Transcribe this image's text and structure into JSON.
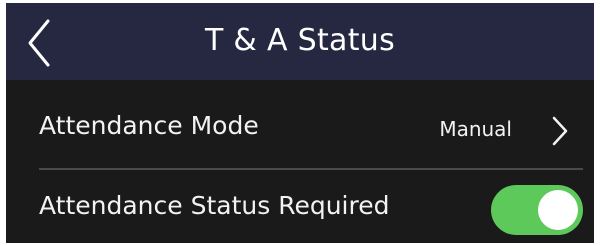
{
  "header": {
    "title": "T & A Status",
    "back_icon": "chevron-left-icon"
  },
  "settings": {
    "attendance_mode": {
      "label": "Attendance Mode",
      "value": "Manual",
      "icon": "chevron-right-icon"
    },
    "attendance_status_required": {
      "label": "Attendance Status Required",
      "enabled": true
    }
  },
  "colors": {
    "header_background": "#262842",
    "screen_background": "#1a1a1a",
    "toggle_on": "#5cc95a",
    "divider": "#4a4a4a"
  }
}
